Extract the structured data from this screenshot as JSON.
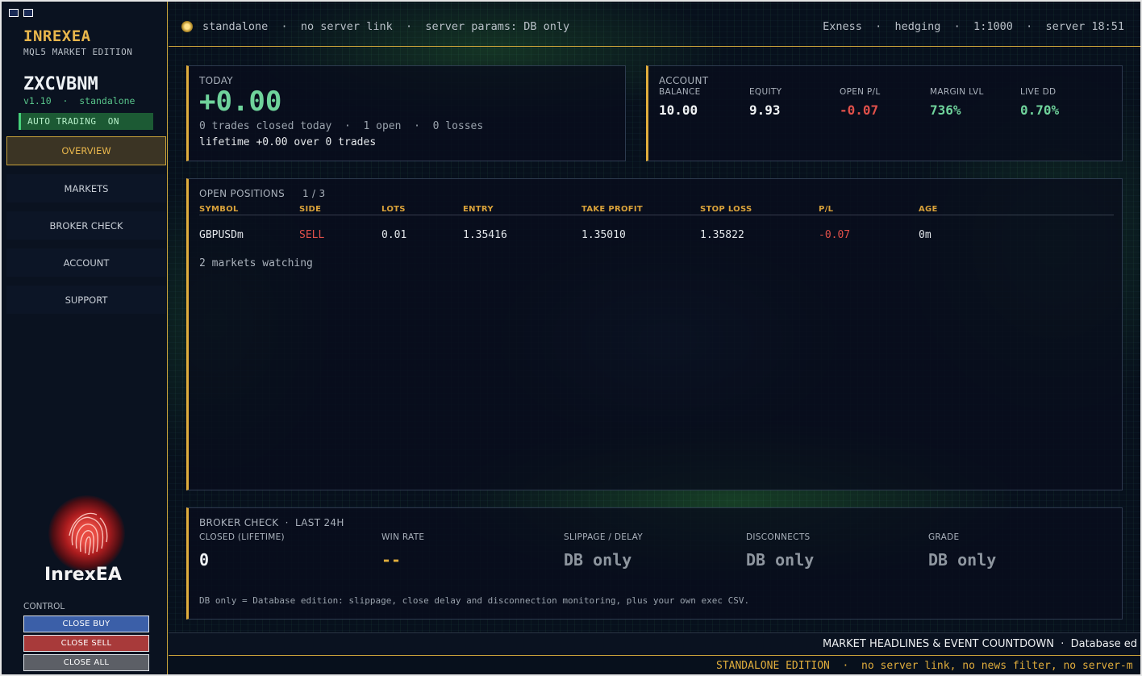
{
  "sidebar": {
    "brand": "INREXEA",
    "edition": "MQL5 MARKET EDITION",
    "account_name": "ZXCVBNM",
    "version_line": "v1.10  ·  standalone",
    "auto_trading": "AUTO TRADING  ON",
    "nav": [
      "OVERVIEW",
      "MARKETS",
      "BROKER CHECK",
      "ACCOUNT",
      "SUPPORT"
    ],
    "logo_text": "InrexEA",
    "control_label": "CONTROL",
    "buttons": {
      "close_buy": "CLOSE BUY",
      "close_sell": "CLOSE SELL",
      "close_all": "CLOSE ALL"
    }
  },
  "topbar": {
    "left": "standalone  ·  no server link  ·  server params: DB only",
    "right": "Exness  ·  hedging  ·  1:1000  ·  server 18:51"
  },
  "today": {
    "label": "TODAY",
    "value": "+0.00",
    "line1": "0 trades closed today  ·  1 open  ·  0 losses",
    "line2": "lifetime +0.00 over 0 trades"
  },
  "account": {
    "label": "ACCOUNT",
    "metrics": [
      {
        "label": "BALANCE",
        "value": "10.00"
      },
      {
        "label": "EQUITY",
        "value": "9.93"
      },
      {
        "label": "OPEN P/L",
        "value": "-0.07"
      },
      {
        "label": "MARGIN LVL",
        "value": "736%"
      },
      {
        "label": "LIVE DD",
        "value": "0.70%"
      }
    ]
  },
  "positions": {
    "title": "OPEN POSITIONS",
    "count": "1 / 3",
    "columns": [
      "SYMBOL",
      "SIDE",
      "LOTS",
      "ENTRY",
      "TAKE PROFIT",
      "STOP LOSS",
      "P/L",
      "AGE"
    ],
    "rows": [
      [
        "GBPUSDm",
        "SELL",
        "0.01",
        "1.35416",
        "1.35010",
        "1.35822",
        "-0.07",
        "0m"
      ]
    ],
    "watching": "2 markets watching"
  },
  "broker": {
    "title": "BROKER CHECK  ·  LAST 24H",
    "metrics": [
      {
        "label": "CLOSED (LIFETIME)",
        "value": "0"
      },
      {
        "label": "WIN RATE",
        "value": "--"
      },
      {
        "label": "SLIPPAGE / DELAY",
        "value": "DB only"
      },
      {
        "label": "DISCONNECTS",
        "value": "DB only"
      },
      {
        "label": "GRADE",
        "value": "DB only"
      }
    ],
    "note": "DB only = Database edition: slippage, close delay and disconnection monitoring, plus your own exec CSV."
  },
  "footer": {
    "headlines": "MARKET HEADLINES & EVENT COUNTDOWN  ·  Database ed",
    "ticker": "STANDALONE EDITION  ·  no server link, no news filter, no server-m"
  },
  "colors": {
    "gold": "#e0ad3c",
    "green": "#6fd39b",
    "red": "#e0504a"
  }
}
